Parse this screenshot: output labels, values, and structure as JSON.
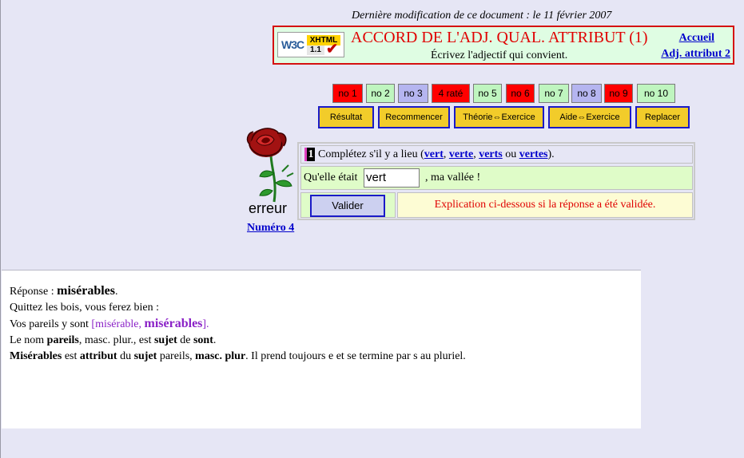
{
  "header": {
    "last_modified": "Dernière modification de ce document : le 11 février 2007",
    "badge": {
      "w3c": "W3C",
      "xhtml": "XHTML",
      "version": "1.1",
      "check": "✔"
    },
    "title": "ACCORD DE L'ADJ. QUAL. ATTRIBUT (1)",
    "subtitle": "Écrivez l'adjectif qui convient.",
    "link_home": "Accueil",
    "link_next": "Adj. attribut 2"
  },
  "nav": [
    {
      "label": "no 1",
      "color": "#ff0000"
    },
    {
      "label": "no 2",
      "color": "#bff5bf"
    },
    {
      "label": "no 3",
      "color": "#b5b5f0"
    },
    {
      "label": "4 raté",
      "color": "#ff0000"
    },
    {
      "label": "no 5",
      "color": "#bff5bf"
    },
    {
      "label": "no 6",
      "color": "#ff0000"
    },
    {
      "label": "no 7",
      "color": "#bff5bf"
    },
    {
      "label": "no 8",
      "color": "#b5b5f0"
    },
    {
      "label": "no 9",
      "color": "#ff0000"
    },
    {
      "label": "no 10",
      "color": "#bff5bf"
    }
  ],
  "actions": {
    "result": "Résultat",
    "restart": "Recommencer",
    "theory": "Théorie⇔Exercice",
    "help": "Aide⇔Exercice",
    "replace": "Replacer"
  },
  "status": {
    "word": "erreur",
    "numero": "Numéro 4"
  },
  "question": {
    "number": "1",
    "prompt": "Complétez s'il y a lieu (",
    "options": [
      "vert",
      "verte",
      "verts",
      "vertes"
    ],
    "sep1": ", ",
    "sep2": ", ",
    "sep3": " ou ",
    "close": ")."
  },
  "sentence": {
    "before": "Qu'elle était",
    "input_value": "vert",
    "after": ", ma vallée !"
  },
  "validate_label": "Valider",
  "explanation_hint": "Explication ci-dessous si la réponse a été validée.",
  "answer": {
    "label": "Réponse : ",
    "word": "misérables",
    "period": ".",
    "line1": "Quittez les bois, vous ferez bien :",
    "line2_pre": "Vos pareils y sont ",
    "line2_bracket_open": "[misérable, ",
    "line2_bracket_word": "misérables",
    "line2_bracket_close": "].",
    "line3_a": "Le nom ",
    "line3_b": "pareils",
    "line3_c": ", masc. plur., est ",
    "line3_d": "sujet",
    "line3_e": " de ",
    "line3_f": "sont",
    "line3_g": ".",
    "line4_a": "Misérables",
    "line4_b": " est ",
    "line4_c": "attribut",
    "line4_d": " du ",
    "line4_e": "sujet",
    "line4_f": " pareils, ",
    "line4_g": "masc. plur",
    "line4_h": ". Il prend toujours e et se termine par s au pluriel."
  }
}
